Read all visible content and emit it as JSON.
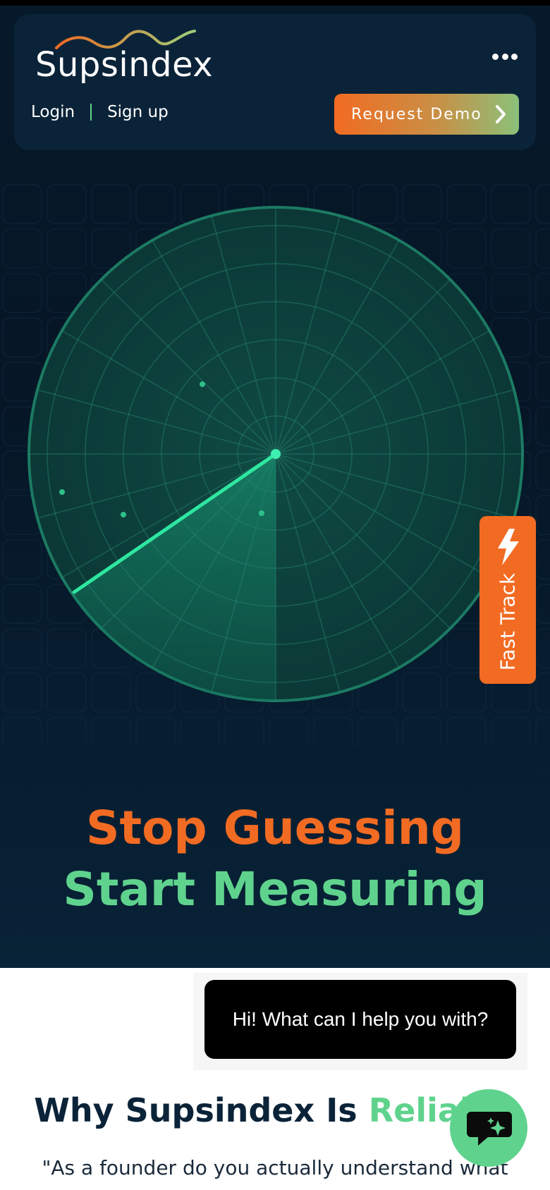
{
  "brand": {
    "name": "Supsindex",
    "accent_orange": "#f26b22",
    "accent_green": "#5fd38d",
    "navy": "#0b2338"
  },
  "header": {
    "login": "Login",
    "signup": "Sign up",
    "cta": "Request Demo",
    "menu_icon": "more-dots-icon"
  },
  "fast_track": {
    "label": "Fast Track",
    "icon": "lightning-bolt-icon"
  },
  "hero": {
    "line1": "Stop Guessing",
    "line2": "Start Measuring"
  },
  "chat": {
    "greeting": "Hi! What can I help you with?",
    "fab_icon": "chat-sparkle-icon"
  },
  "section": {
    "title_start": "Why Supsindex Is ",
    "title_accent": "Reliable",
    "quote": "\"As a founder do you actually understand what"
  }
}
